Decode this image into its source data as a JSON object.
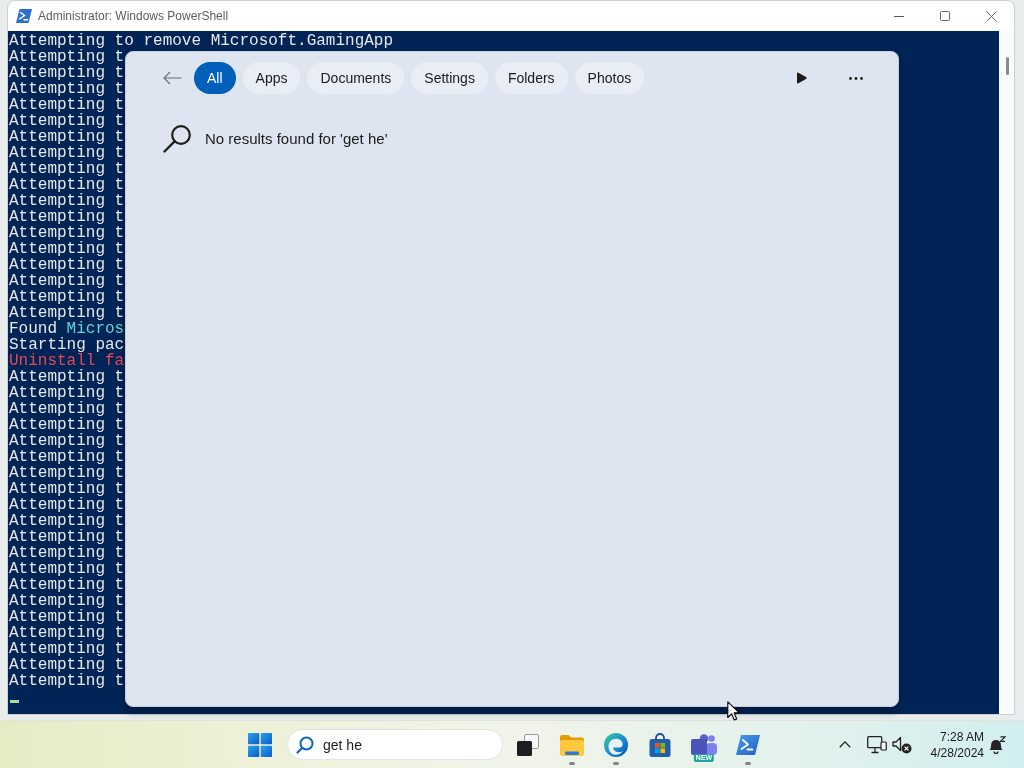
{
  "window": {
    "title": "Administrator: Windows PowerShell"
  },
  "console": {
    "lines": [
      {
        "segments": [
          {
            "text": "Attempting to remove Microsoft.GamingApp",
            "color": "#e8e8e8"
          }
        ]
      },
      {
        "segments": [
          {
            "text": "Attempting t",
            "color": "#e8e8e8"
          }
        ]
      },
      {
        "segments": [
          {
            "text": "Attempting t",
            "color": "#e8e8e8"
          }
        ]
      },
      {
        "segments": [
          {
            "text": "Attempting t",
            "color": "#e8e8e8"
          }
        ]
      },
      {
        "segments": [
          {
            "text": "Attempting t",
            "color": "#e8e8e8"
          }
        ]
      },
      {
        "segments": [
          {
            "text": "Attempting t",
            "color": "#e8e8e8"
          }
        ]
      },
      {
        "segments": [
          {
            "text": "Attempting t",
            "color": "#e8e8e8"
          }
        ]
      },
      {
        "segments": [
          {
            "text": "Attempting t",
            "color": "#e8e8e8"
          }
        ]
      },
      {
        "segments": [
          {
            "text": "Attempting t",
            "color": "#e8e8e8"
          }
        ]
      },
      {
        "segments": [
          {
            "text": "Attempting t",
            "color": "#e8e8e8"
          }
        ]
      },
      {
        "segments": [
          {
            "text": "Attempting t",
            "color": "#e8e8e8"
          }
        ]
      },
      {
        "segments": [
          {
            "text": "Attempting t",
            "color": "#e8e8e8"
          }
        ]
      },
      {
        "segments": [
          {
            "text": "Attempting t",
            "color": "#e8e8e8"
          }
        ]
      },
      {
        "segments": [
          {
            "text": "Attempting t",
            "color": "#e8e8e8"
          }
        ]
      },
      {
        "segments": [
          {
            "text": "Attempting t",
            "color": "#e8e8e8"
          }
        ]
      },
      {
        "segments": [
          {
            "text": "Attempting t",
            "color": "#e8e8e8"
          }
        ]
      },
      {
        "segments": [
          {
            "text": "Attempting t",
            "color": "#e8e8e8"
          }
        ]
      },
      {
        "segments": [
          {
            "text": "Attempting t",
            "color": "#e8e8e8"
          }
        ]
      },
      {
        "segments": [
          {
            "text": "Found ",
            "color": "#e8e8e8"
          },
          {
            "text": "Micros",
            "color": "#61d6d6"
          }
        ]
      },
      {
        "segments": [
          {
            "text": "Starting pac",
            "color": "#e8e8e8"
          }
        ]
      },
      {
        "segments": [
          {
            "text": "Uninstall fa",
            "color": "#e74856"
          }
        ]
      },
      {
        "segments": [
          {
            "text": "Attempting t",
            "color": "#e8e8e8"
          }
        ]
      },
      {
        "segments": [
          {
            "text": "Attempting t",
            "color": "#e8e8e8"
          }
        ]
      },
      {
        "segments": [
          {
            "text": "Attempting t",
            "color": "#e8e8e8"
          }
        ]
      },
      {
        "segments": [
          {
            "text": "Attempting t",
            "color": "#e8e8e8"
          }
        ]
      },
      {
        "segments": [
          {
            "text": "Attempting t",
            "color": "#e8e8e8"
          }
        ]
      },
      {
        "segments": [
          {
            "text": "Attempting t",
            "color": "#e8e8e8"
          }
        ]
      },
      {
        "segments": [
          {
            "text": "Attempting t",
            "color": "#e8e8e8"
          }
        ]
      },
      {
        "segments": [
          {
            "text": "Attempting t",
            "color": "#e8e8e8"
          }
        ]
      },
      {
        "segments": [
          {
            "text": "Attempting t",
            "color": "#e8e8e8"
          }
        ]
      },
      {
        "segments": [
          {
            "text": "Attempting t",
            "color": "#e8e8e8"
          }
        ]
      },
      {
        "segments": [
          {
            "text": "Attempting t",
            "color": "#e8e8e8"
          }
        ]
      },
      {
        "segments": [
          {
            "text": "Attempting t",
            "color": "#e8e8e8"
          }
        ]
      },
      {
        "segments": [
          {
            "text": "Attempting t",
            "color": "#e8e8e8"
          }
        ]
      },
      {
        "segments": [
          {
            "text": "Attempting t",
            "color": "#e8e8e8"
          }
        ]
      },
      {
        "segments": [
          {
            "text": "Attempting t",
            "color": "#e8e8e8"
          }
        ]
      },
      {
        "segments": [
          {
            "text": "Attempting t",
            "color": "#e8e8e8"
          }
        ]
      },
      {
        "segments": [
          {
            "text": "Attempting t",
            "color": "#e8e8e8"
          }
        ]
      },
      {
        "segments": [
          {
            "text": "Attempting t",
            "color": "#e8e8e8"
          }
        ]
      },
      {
        "segments": [
          {
            "text": "Attempting t",
            "color": "#e8e8e8"
          }
        ]
      },
      {
        "segments": [
          {
            "text": "Attempting t",
            "color": "#e8e8e8"
          }
        ]
      }
    ]
  },
  "search_panel": {
    "filters": [
      {
        "label": "All",
        "selected": true
      },
      {
        "label": "Apps",
        "selected": false
      },
      {
        "label": "Documents",
        "selected": false
      },
      {
        "label": "Settings",
        "selected": false
      },
      {
        "label": "Folders",
        "selected": false
      },
      {
        "label": "Photos",
        "selected": false
      }
    ],
    "message": "No results found for 'get he'"
  },
  "taskbar": {
    "search": {
      "value": "get he"
    },
    "apps": [
      {
        "kind": "task_view",
        "running": false
      },
      {
        "kind": "folder",
        "running": true
      },
      {
        "kind": "browser",
        "running": true
      },
      {
        "kind": "store",
        "running": false
      },
      {
        "kind": "chat",
        "running": false,
        "badge": "NEW"
      },
      {
        "kind": "terminal",
        "running": true
      }
    ],
    "clock": {
      "time": "7:28 AM",
      "date": "4/28/2024"
    }
  }
}
